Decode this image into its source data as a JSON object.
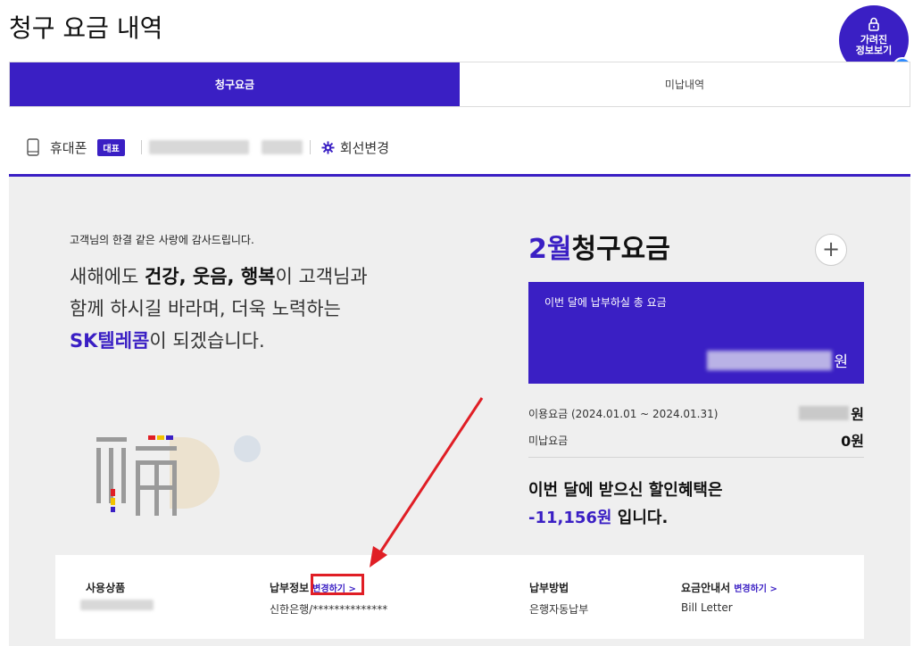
{
  "header": {
    "title": "청구 요금 내역",
    "hidden_info_button": {
      "line1": "가려진",
      "line2": "정보보기",
      "help": "?"
    }
  },
  "tabs": [
    {
      "label": "청구요금",
      "active": true
    },
    {
      "label": "미납내역",
      "active": false
    }
  ],
  "line": {
    "type": "휴대폰",
    "badge": "대표",
    "change_label": "회선변경"
  },
  "greeting": {
    "small": "고객님의 한결 같은 사랑에 감사드립니다.",
    "line1_pre": "새해에도 ",
    "line1_bold": "건강, 웃음, 행복",
    "line1_post": "이 고객님과",
    "line2": "함께 하시길 바라며, 더욱 노력하는",
    "line3_brand": "SK텔레콤",
    "line3_post": "이 되겠습니다."
  },
  "bill": {
    "month": "2월",
    "title": "청구요금",
    "total_label": "이번 달에 납부하실 총 요금",
    "total_unit": "원",
    "usage_label": "이용요금 (2024.01.01 ~ 2024.01.31)",
    "usage_unit": "원",
    "unpaid_label": "미납요금",
    "unpaid_value": "0원",
    "discount_line1": "이번 달에 받으신 할인혜택은",
    "discount_amount": "-11,156원",
    "discount_suffix": " 입니다."
  },
  "info": {
    "product_label": "사용상품",
    "payment_info_label": "납부정보",
    "payment_info_change": "변경하기 >",
    "payment_info_value": "신한은행/**************",
    "payment_method_label": "납부방법",
    "payment_method_value": "은행자동납부",
    "statement_label": "요금안내서",
    "statement_change": "변경하기 >",
    "statement_value": "Bill Letter"
  },
  "colors": {
    "brand": "#3a1fc4",
    "annotation_red": "#e01e25",
    "panel_bg": "#efefef"
  }
}
